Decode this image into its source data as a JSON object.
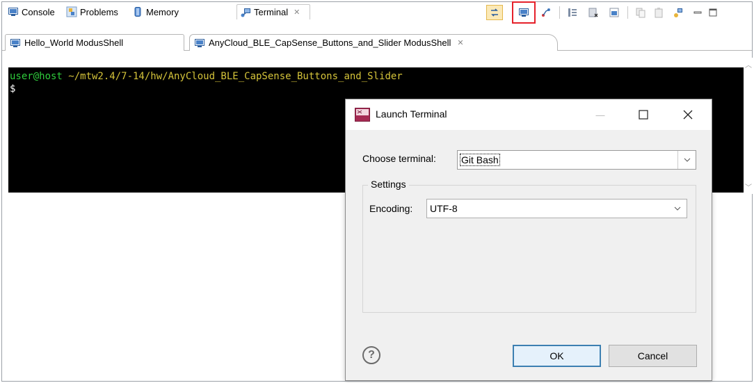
{
  "view_tabs": [
    {
      "label": "Console",
      "icon": "console-icon"
    },
    {
      "label": "Problems",
      "icon": "problems-icon"
    },
    {
      "label": "Memory",
      "icon": "memory-icon"
    },
    {
      "label": "Terminal",
      "icon": "terminal-icon",
      "close": "✕"
    }
  ],
  "terminal_tabs": [
    {
      "label": "Hello_World ModusShell"
    },
    {
      "label": "AnyCloud_BLE_CapSense_Buttons_and_Slider ModusShell",
      "close": "✕"
    }
  ],
  "terminal": {
    "user_host": "user@host",
    "path": " ~/mtw2.4/7-14/hw/AnyCloud_BLE_CapSense_Buttons_and_Slider",
    "prompt": "$"
  },
  "dialog": {
    "title": "Launch Terminal",
    "choose_label": "Choose terminal:",
    "choose_value": "Git Bash",
    "settings_label": "Settings",
    "encoding_label": "Encoding:",
    "encoding_value": "UTF-8",
    "help": "?",
    "ok_label": "OK",
    "cancel_label": "Cancel"
  },
  "colors": {
    "highlight": "#e5202a",
    "terminal_bg": "#000000",
    "prompt_green": "#2fcc3c",
    "path_yellow": "#d4c33a"
  }
}
